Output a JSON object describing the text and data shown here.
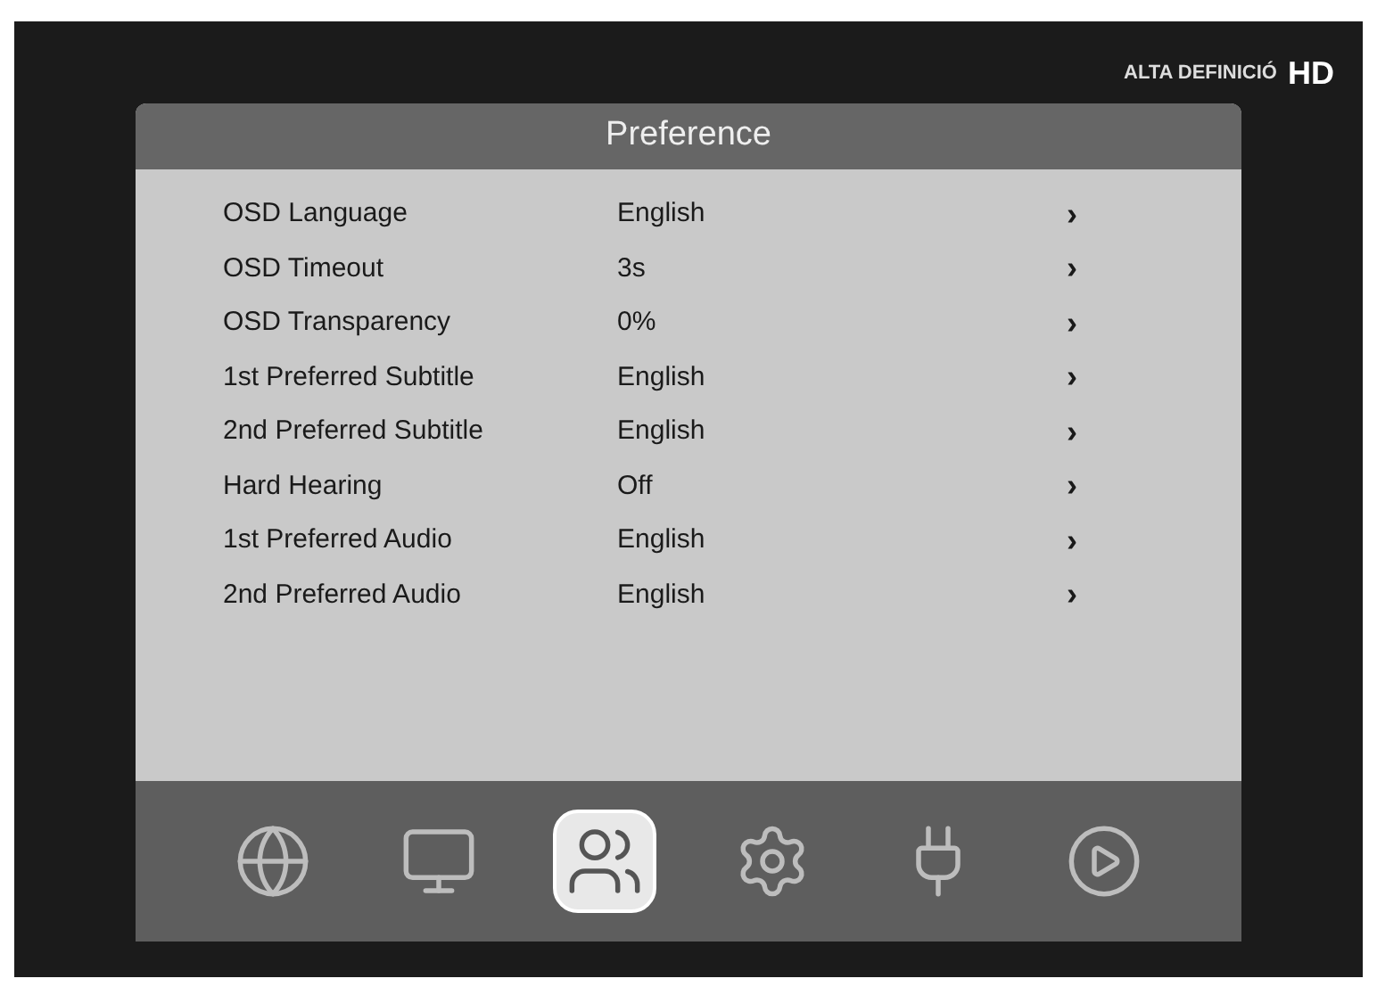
{
  "channel_logo": {
    "text": "ALTA DEFINICIÓ",
    "badge": "HD"
  },
  "menu": {
    "title": "Preference",
    "rows": [
      {
        "label": "OSD Language",
        "value": "English",
        "arrow": "›"
      },
      {
        "label": "OSD Timeout",
        "value": "3s",
        "arrow": "›"
      },
      {
        "label": "OSD Transparency",
        "value": "0%",
        "arrow": "›"
      },
      {
        "label": "1st Preferred Subtitle",
        "value": "English",
        "arrow": "›"
      },
      {
        "label": "2nd Preferred Subtitle",
        "value": "English",
        "arrow": "›"
      },
      {
        "label": "Hard Hearing",
        "value": "Off",
        "arrow": "›"
      },
      {
        "label": "1st Preferred Audio",
        "value": "English",
        "arrow": "›"
      },
      {
        "label": "2nd Preferred Audio",
        "value": "English",
        "arrow": "›"
      }
    ]
  },
  "categories": [
    {
      "kind": "installation",
      "selected": false
    },
    {
      "kind": "picture",
      "selected": false
    },
    {
      "kind": "preference",
      "selected": true
    },
    {
      "kind": "system",
      "selected": false
    },
    {
      "kind": "connection",
      "selected": false
    },
    {
      "kind": "media",
      "selected": false
    }
  ]
}
